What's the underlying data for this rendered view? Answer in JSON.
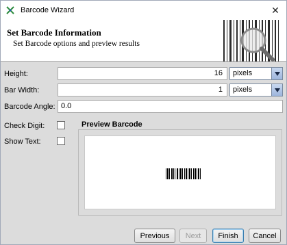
{
  "window": {
    "title": "Barcode Wizard",
    "close_glyph": "✕"
  },
  "header": {
    "title": "Set Barcode Information",
    "subtitle": "Set Barcode options and preview results"
  },
  "form": {
    "height": {
      "label": "Height:",
      "value": "16",
      "unit": "pixels"
    },
    "bar_width": {
      "label": "Bar Width:",
      "value": "1",
      "unit": "pixels"
    },
    "barcode_angle": {
      "label": "Barcode Angle:",
      "value": "0.0"
    },
    "check_digit": {
      "label": "Check Digit:",
      "checked": false
    },
    "show_text": {
      "label": "Show Text:",
      "checked": false
    }
  },
  "preview": {
    "label": "Preview Barcode"
  },
  "buttons": {
    "previous": "Previous",
    "next": "Next",
    "finish": "Finish",
    "cancel": "Cancel"
  },
  "icons": {
    "app": "barcode-wizard-icon",
    "close": "close-icon",
    "header_art": "barcode-magnifier-icon",
    "dropdown": "chevron-down-icon"
  }
}
